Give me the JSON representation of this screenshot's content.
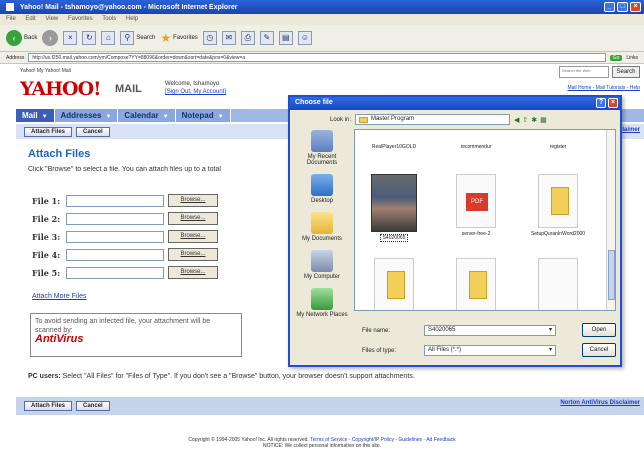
{
  "window": {
    "title": "Yahoo! Mail - tshamoyo@yahoo.com - Microsoft Internet Explorer",
    "menus": [
      "File",
      "Edit",
      "View",
      "Favorites",
      "Tools",
      "Help"
    ]
  },
  "toolbar": {
    "back_label": "Back",
    "search_label": "Search",
    "favorites_label": "Favorites"
  },
  "address": {
    "label": "Address",
    "url": "http://us.f250.mail.yahoo.com/ym/Compose?YY=88096&order=down&sort=date&pos=0&view=a",
    "go_label": "Go",
    "links_label": "Links"
  },
  "yahoo": {
    "top_links": "Yahoo! My Yahoo! Mail",
    "logo": "YAHOO!",
    "logo_suffix": "MAIL",
    "welcome": "Welcome, tshamoyo",
    "account_links": "[Sign Out, My Account]",
    "search_placeholder": "Search the Web",
    "search_button": "Search",
    "right_links": "Mail Home - Mail Tutorials - Help"
  },
  "tabs": [
    {
      "label": "Mail"
    },
    {
      "label": "Addresses"
    },
    {
      "label": "Calendar"
    },
    {
      "label": "Notepad"
    }
  ],
  "actions": {
    "attach_files": "Attach Files",
    "cancel": "Cancel",
    "norton_link": "Norton AntiVirus Disclaimer"
  },
  "attach": {
    "title": "Attach Files",
    "instruction": "Click \"Browse\" to select a file. You can attach files up to a total",
    "file_labels": [
      "File 1:",
      "File 2:",
      "File 3:",
      "File 4:",
      "File 5:"
    ],
    "browse_label": "Browse...",
    "attach_more": "Attach More Files",
    "av_text": "To avoid sending an infected file, your attachment will be scanned by:",
    "av_brand": "AntiVirus",
    "pc_users_bold": "PC users:",
    "pc_users_text": "Select \"All Files\" for \"Files of Type\". If you don't see a \"Browse\" button, your browser doesn't support attachments."
  },
  "footer": {
    "copyright": "Copyright © 1994-2005 Yahoo! Inc. All rights reserved.",
    "links": "Terms of Service - Copyright/IP Policy - Guidelines - Ad Feedback",
    "notice": "NOTICE: We collect personal information on this site."
  },
  "dialog": {
    "title": "Choose file",
    "look_in_label": "Look in:",
    "look_in_value": "Master Program",
    "places": [
      "My Recent Documents",
      "Desktop",
      "My Documents",
      "My Computer",
      "My Network Places"
    ],
    "files": [
      {
        "name": "RealPlayer10GOLD",
        "kind": "none"
      },
      {
        "name": "recommendur",
        "kind": "none"
      },
      {
        "name": "register",
        "kind": "none"
      },
      {
        "name": "S4020065",
        "kind": "photo"
      },
      {
        "name": "server-free-2",
        "kind": "pdf"
      },
      {
        "name": "SetupQuranInWord2000",
        "kind": "folder"
      },
      {
        "name": "",
        "kind": "folder"
      },
      {
        "name": "",
        "kind": "folder"
      },
      {
        "name": "",
        "kind": "blank"
      }
    ],
    "file_name_label": "File name:",
    "file_name_value": "S4020065",
    "file_type_label": "Files of type:",
    "file_type_value": "All Files (*.*)",
    "open_label": "Open",
    "cancel_label": "Cancel"
  }
}
